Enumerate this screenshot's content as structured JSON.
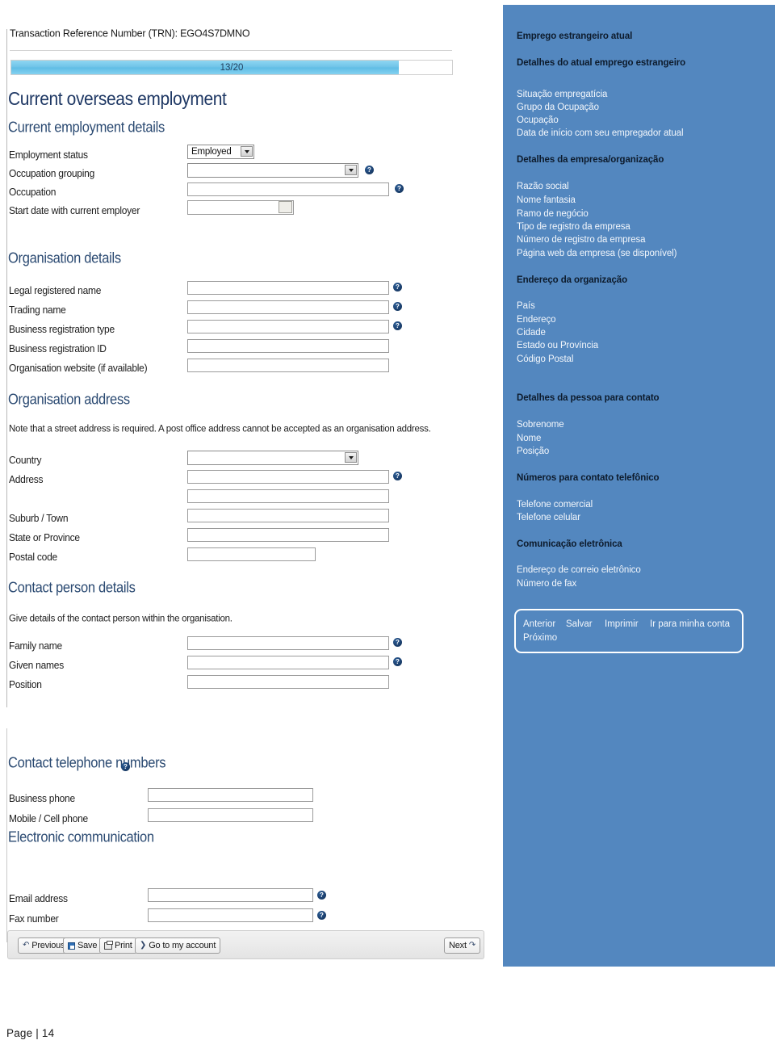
{
  "document": {
    "page_label": "Page | 14"
  },
  "form": {
    "transaction_reference": "Transaction Reference Number (TRN): EGO4S7DMNO",
    "progress": {
      "label": "13/20",
      "current": 13,
      "total": 20,
      "percent": 88
    },
    "page_title": "Current overseas employment",
    "sections": [
      {
        "id": "current-employment-details",
        "heading": "Current employment details",
        "fields": [
          {
            "label": "Employment status",
            "control": "select",
            "value": "Employed",
            "help": false
          },
          {
            "label": "Occupation grouping",
            "control": "select",
            "value": "",
            "help": true
          },
          {
            "label": "Occupation",
            "control": "text",
            "value": "",
            "help": true
          },
          {
            "label": "Start date with current employer",
            "control": "date",
            "value": "",
            "help": false
          }
        ]
      },
      {
        "id": "organisation-details",
        "heading": "Organisation details",
        "fields": [
          {
            "label": "Legal registered name",
            "control": "text",
            "value": "",
            "help": true
          },
          {
            "label": "Trading name",
            "control": "text",
            "value": "",
            "help": true
          },
          {
            "label": "Business registration type",
            "control": "text",
            "value": "",
            "help": true
          },
          {
            "label": "Business registration ID",
            "control": "text",
            "value": "",
            "help": false
          },
          {
            "label": "Organisation website (if available)",
            "control": "text",
            "value": "",
            "help": false
          }
        ]
      },
      {
        "id": "organisation-address",
        "heading": "Organisation address",
        "note": "Note that a street address is required. A post office address cannot be accepted as an organisation address.",
        "fields": [
          {
            "label": "Country",
            "control": "select",
            "value": "",
            "help": false
          },
          {
            "label": "Address",
            "control": "text",
            "value": "",
            "help": true
          },
          {
            "label": "",
            "control": "text",
            "value": "",
            "help": false
          },
          {
            "label": "Suburb / Town",
            "control": "text",
            "value": "",
            "help": false
          },
          {
            "label": "State or Province",
            "control": "text",
            "value": "",
            "help": false
          },
          {
            "label": "Postal code",
            "control": "text",
            "value": "",
            "help": false
          }
        ]
      },
      {
        "id": "contact-person-details",
        "heading": "Contact person details",
        "note": "Give details of the contact person within the organisation.",
        "fields": [
          {
            "label": "Family name",
            "control": "text",
            "value": "",
            "help": true
          },
          {
            "label": "Given names",
            "control": "text",
            "value": "",
            "help": true
          },
          {
            "label": "Position",
            "control": "text",
            "value": "",
            "help": false
          }
        ]
      },
      {
        "id": "contact-telephone-numbers",
        "heading": "Contact telephone numbers",
        "heading_help": true,
        "fields": [
          {
            "label": "Business phone",
            "control": "text",
            "value": "",
            "help": false
          },
          {
            "label": "Mobile / Cell phone",
            "control": "text",
            "value": "",
            "help": false
          }
        ]
      },
      {
        "id": "electronic-communication",
        "heading": "Electronic communication",
        "fields": [
          {
            "label": "Email address",
            "control": "text",
            "value": "",
            "help": true
          },
          {
            "label": "Fax number",
            "control": "text",
            "value": "",
            "help": true
          }
        ]
      }
    ],
    "toolbar": {
      "previous": "Previous",
      "save": "Save",
      "print": "Print",
      "go_to_account": "Go to my account",
      "next": "Next"
    }
  },
  "translation_panel": {
    "accent_color": "#5387bf",
    "title": "Emprego estrangeiro atual",
    "groups": [
      {
        "heading": "Detalhes do atual emprego estrangeiro",
        "items": [
          "Situação empregatícia",
          "Grupo da Ocupação",
          "Ocupação",
          "Data de início com seu empregador atual"
        ]
      },
      {
        "heading": "Detalhes da empresa/organização",
        "items": [
          "Razão social",
          "Nome fantasia",
          "Ramo de negócio",
          "Tipo de registro da empresa",
          "Número de registro da empresa",
          "Página web da empresa (se disponível)"
        ]
      },
      {
        "heading": "Endereço da organização",
        "items": [
          "País",
          "Endereço",
          "Cidade",
          "Estado ou Província",
          "Código Postal"
        ]
      },
      {
        "heading": "Detalhes da pessoa para contato",
        "items": [
          "Sobrenome",
          "Nome",
          "Posição"
        ]
      },
      {
        "heading": "Números para contato telefônico",
        "items": [
          "Telefone comercial",
          "Telefone celular"
        ]
      },
      {
        "heading": "Comunicação eletrônica",
        "items": [
          "Endereço de correio eletrônico",
          "Número de fax"
        ]
      }
    ],
    "buttons": [
      "Anterior",
      "Salvar",
      "Imprimir",
      "Ir para minha conta",
      "Próximo"
    ]
  }
}
